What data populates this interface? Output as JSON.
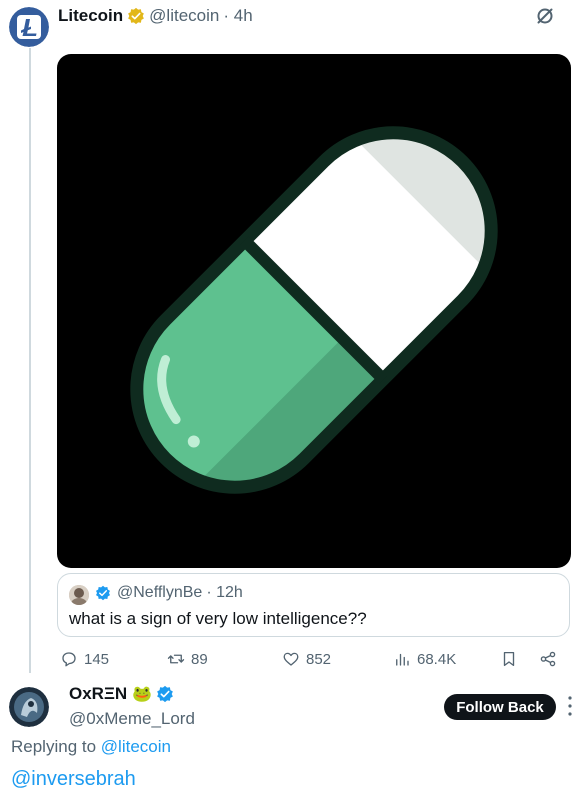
{
  "tweet": {
    "author_name": "Litecoin",
    "author_handle": "@litecoin",
    "time": "· 4h",
    "avatar_letter": "Ł",
    "brand_color": "#345d9d",
    "gold_badge_color": "#e2b719"
  },
  "quote": {
    "handle": "@NefflynBe",
    "time": "· 12h",
    "text": "what is a sign of very low intelligence??"
  },
  "actions": {
    "replies": "145",
    "retweets": "89",
    "likes": "852",
    "views": "68.4K"
  },
  "reply": {
    "name": "OxRΞN",
    "emoji": "🐸",
    "handle": "@0xMeme_Lord",
    "follow_label": "Follow Back",
    "replying_prefix": "Replying to",
    "replying_target": "@litecoin",
    "mention": "@inversebrah"
  },
  "colors": {
    "accent": "#1d9bf0",
    "pill_green": "#5ec18f",
    "pill_white": "#ffffff",
    "pill_outline": "#0f2b1f"
  }
}
